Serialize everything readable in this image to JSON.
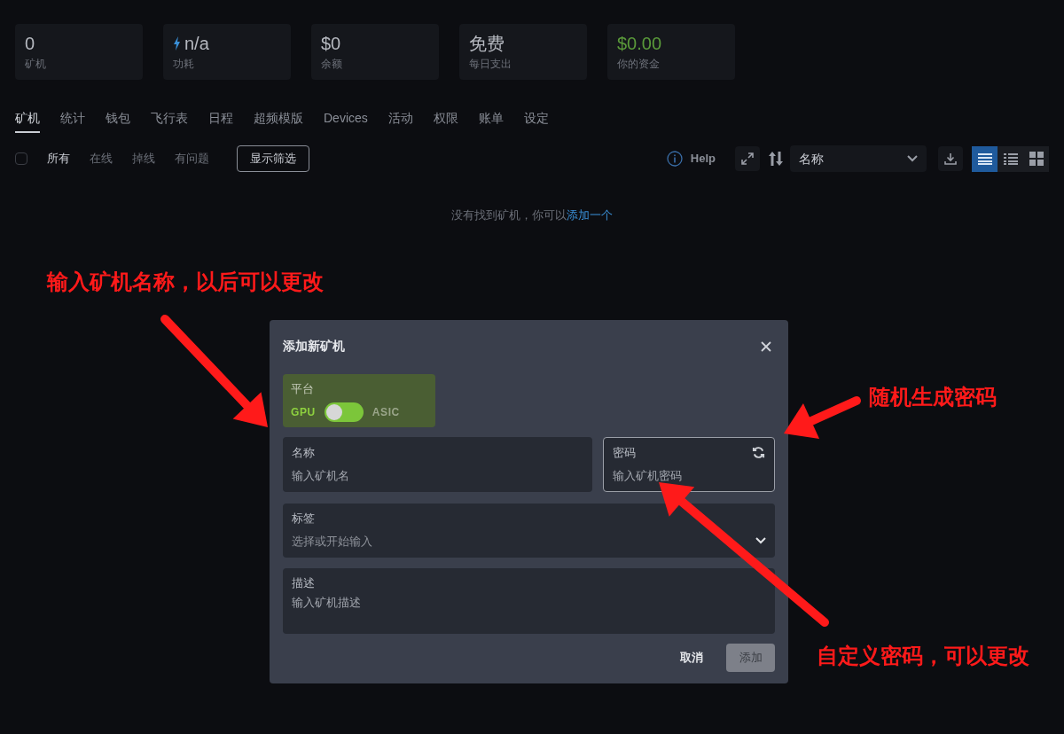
{
  "stats": [
    {
      "value": "0",
      "label": "矿机",
      "kind": "plain"
    },
    {
      "value": "n/a",
      "label": "功耗",
      "kind": "power"
    },
    {
      "value": "$0",
      "label": "余额",
      "kind": "plain"
    },
    {
      "value": "免费",
      "label": "每日支出",
      "kind": "plain"
    },
    {
      "value": "$0.00",
      "label": "你的资金",
      "kind": "money"
    }
  ],
  "tabs": [
    {
      "label": "矿机",
      "selected": true
    },
    {
      "label": "统计",
      "selected": false
    },
    {
      "label": "钱包",
      "selected": false
    },
    {
      "label": "飞行表",
      "selected": false
    },
    {
      "label": "日程",
      "selected": false
    },
    {
      "label": "超频模版",
      "selected": false
    },
    {
      "label": "Devices",
      "selected": false
    },
    {
      "label": "活动",
      "selected": false
    },
    {
      "label": "权限",
      "selected": false
    },
    {
      "label": "账单",
      "selected": false
    },
    {
      "label": "设定",
      "selected": false
    }
  ],
  "filter": {
    "checked": false,
    "options": [
      {
        "label": "所有",
        "selected": true
      },
      {
        "label": "在线",
        "selected": false
      },
      {
        "label": "掉线",
        "selected": false
      },
      {
        "label": "有问题",
        "selected": false
      }
    ],
    "button": "显示筛选"
  },
  "toolbar": {
    "help": "Help",
    "sort": "名称",
    "views": [
      {
        "kind": "list",
        "selected": true
      },
      {
        "kind": "table",
        "selected": false
      },
      {
        "kind": "grid",
        "selected": false
      }
    ]
  },
  "empty": {
    "text": "没有找到矿机，你可以",
    "link": "添加一个"
  },
  "dialog": {
    "title": "添加新矿机",
    "platform": {
      "label": "平台",
      "left": "GPU",
      "right": "ASIC",
      "on": false
    },
    "name": {
      "label": "名称",
      "placeholder": "输入矿机名"
    },
    "password": {
      "label": "密码",
      "placeholder": "输入矿机密码"
    },
    "tags": {
      "label": "标签",
      "placeholder": "选择或开始输入"
    },
    "description": {
      "label": "描述",
      "placeholder": "输入矿机描述"
    },
    "buttons": {
      "cancel": "取消",
      "add": "添加"
    }
  },
  "annotations": [
    {
      "text": "输入矿机名称，以后可以更改"
    },
    {
      "text": "随机生成密码"
    },
    {
      "text": "自定义密码，可以更改"
    }
  ]
}
